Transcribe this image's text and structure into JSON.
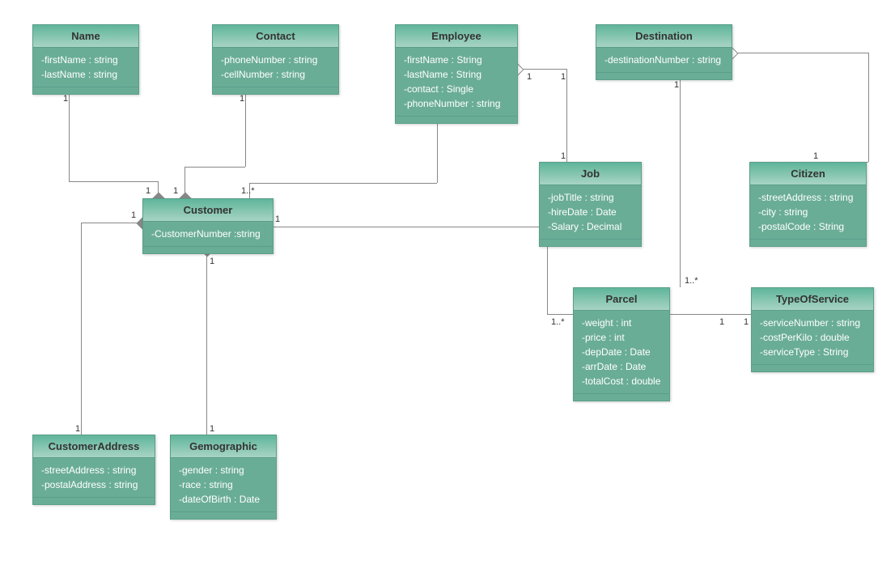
{
  "classes": {
    "name": {
      "title": "Name",
      "attrs": [
        "-firstName : string",
        "-lastName : string"
      ]
    },
    "contact": {
      "title": "Contact",
      "attrs": [
        "-phoneNumber : string",
        "-cellNumber : string"
      ]
    },
    "employee": {
      "title": "Employee",
      "attrs": [
        "-firstName : String",
        "-lastName : String",
        "-contact : Single",
        "-phoneNumber : string"
      ]
    },
    "destination": {
      "title": "Destination",
      "attrs": [
        "-destinationNumber : string"
      ]
    },
    "job": {
      "title": "Job",
      "attrs": [
        "-jobTitle : string",
        "-hireDate : Date",
        "-Salary : Decimal"
      ]
    },
    "citizen": {
      "title": "Citizen",
      "attrs": [
        "-streetAddress : string",
        "-city : string",
        "-postalCode : String"
      ]
    },
    "customer": {
      "title": "Customer",
      "attrs": [
        "-CustomerNumber :string"
      ]
    },
    "parcel": {
      "title": "Parcel",
      "attrs": [
        "-weight : int",
        "-price : int",
        "-depDate : Date",
        "-arrDate : Date",
        "-totalCost : double"
      ]
    },
    "typeofservice": {
      "title": "TypeOfService",
      "attrs": [
        "-serviceNumber : string",
        "-costPerKilo : double",
        "-serviceType : String"
      ]
    },
    "customeraddress": {
      "title": "CustomerAddress",
      "attrs": [
        "-streetAddress : string",
        "-postalAddress : string"
      ]
    },
    "gemographic": {
      "title": "Gemographic",
      "attrs": [
        "-gender : string",
        "-race : string",
        "-dateOfBirth : Date"
      ]
    }
  },
  "multiplicities": {
    "name_customer_name": "1",
    "name_customer_cust": "1",
    "contact_customer_contact": "1",
    "contact_customer_cust": "1",
    "employee_customer_emp": "1",
    "employee_customer_cust": "1..*",
    "employee_job_emp": "1",
    "employee_job_job": "1",
    "destination_citizen_dest": "1",
    "destination_citizen_cit": "1",
    "destination_parcel_dest": "1",
    "destination_parcel_parcel": "1..*",
    "customer_address_cust": "1",
    "customer_address_addr": "1",
    "customer_gemo_cust": "1",
    "customer_gemo_gemo": "1",
    "customer_parcel_cust": "1",
    "customer_parcel_parcel": "1..*",
    "parcel_tos_parcel": "1",
    "parcel_tos_tos": "1"
  }
}
